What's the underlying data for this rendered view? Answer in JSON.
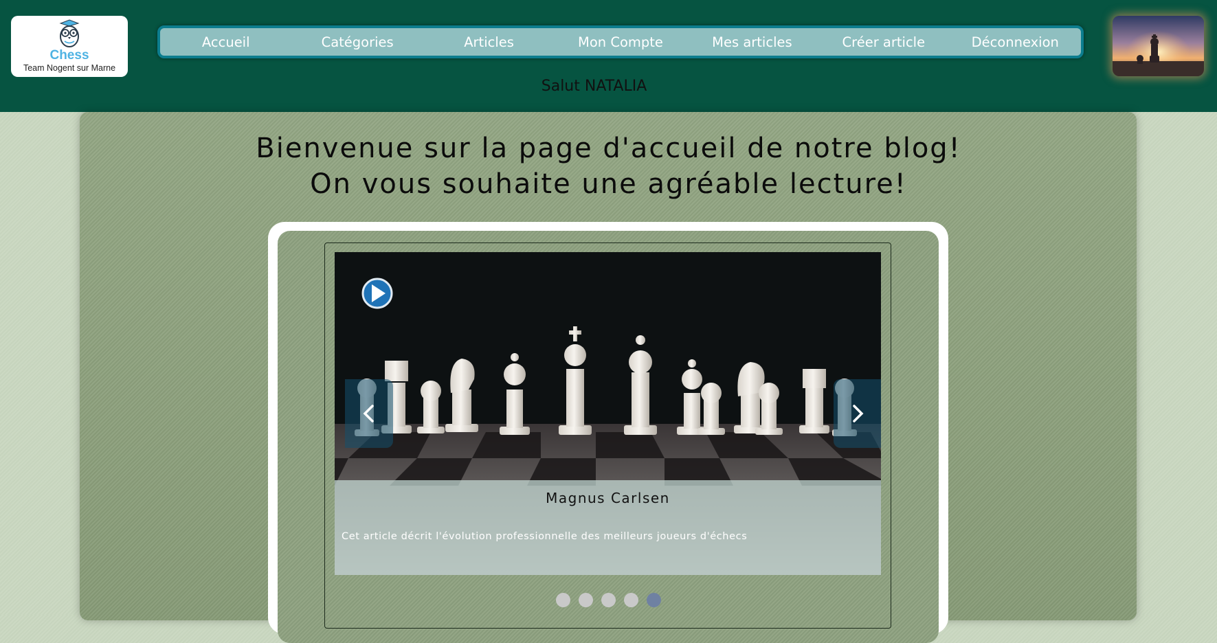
{
  "logo": {
    "title": "Chess",
    "subtitle": "Team Nogent sur Marne",
    "icon": "owl-logo-icon"
  },
  "nav": {
    "items": [
      {
        "label": "Accueil"
      },
      {
        "label": "Catégories"
      },
      {
        "label": "Articles"
      },
      {
        "label": "Mon Compte"
      },
      {
        "label": "Mes articles"
      },
      {
        "label": "Créer article"
      },
      {
        "label": "Déconnexion"
      }
    ]
  },
  "greeting": "Salut NATALIA",
  "welcome": {
    "line1": "Bienvenue sur la page d'accueil de notre blog!",
    "line2": "On vous souhaite une agréable lecture!"
  },
  "carousel": {
    "slide_title": "Magnus Carlsen",
    "slide_text": "Cet article décrit l'évolution professionnelle des meilleurs joueurs d'échecs",
    "dot_count": 5,
    "active_dot": 5,
    "prev_icon": "chevron-left-icon",
    "next_icon": "chevron-right-icon",
    "play_icon": "play-icon"
  },
  "colors": {
    "header_bg": "#065441",
    "nav_bg": "#8fbfc0",
    "nav_border": "#0c7d8e",
    "logo_title": "#4fb3e3",
    "active_dot": "#6f81a2"
  }
}
